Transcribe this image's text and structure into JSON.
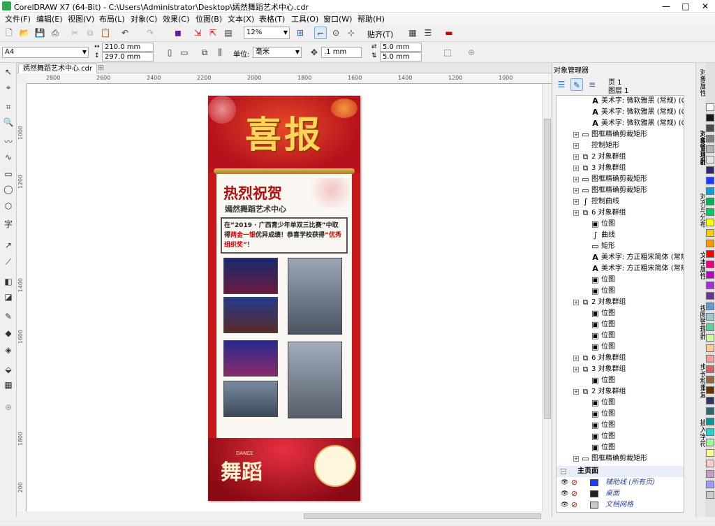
{
  "window": {
    "title": "CorelDRAW X7 (64-Bit) - C:\\Users\\Administrator\\Desktop\\嫣然舞蹈艺术中心.cdr",
    "minimize": "—",
    "maximize": "□",
    "close": "✕"
  },
  "menu": [
    "文件(F)",
    "编辑(E)",
    "视图(V)",
    "布局(L)",
    "对象(C)",
    "效果(C)",
    "位图(B)",
    "文本(X)",
    "表格(T)",
    "工具(O)",
    "窗口(W)",
    "帮助(H)"
  ],
  "toolbar": {
    "zoom": "12%",
    "snap_label": "贴齐(T)"
  },
  "propertybar": {
    "page_size": "A4",
    "width": "210.0 mm",
    "height": "297.0 mm",
    "unit_label": "单位:",
    "unit": "毫米",
    "nudge": ".1 mm",
    "dup_x": "5.0 mm",
    "dup_y": "5.0 mm"
  },
  "document": {
    "tab": "嫣然舞蹈艺术中心.cdr",
    "ruler_h": [
      "2800",
      "2600",
      "2400",
      "2200",
      "2000",
      "1800",
      "1600",
      "1400",
      "1200",
      "1000"
    ],
    "ruler_v": [
      "1000",
      "1200",
      "1400",
      "1600",
      "1800",
      "200"
    ]
  },
  "poster": {
    "title": "喜报",
    "headline": "热烈祝贺",
    "school": "嫣然舞蹈艺术中心",
    "body_1": "在“2019 · 广西青少年单双三比赛”中取得",
    "body_highlight_1": "两金一银",
    "body_2": "优异成绩！恭喜学校获得",
    "body_highlight_2": "“优秀组织奖”",
    "body_end": "！",
    "dance": "舞蹈",
    "dance_en": "DANCE"
  },
  "object_manager": {
    "title": "对象管理器",
    "page": "页 1",
    "layer": "图层 1",
    "rows": [
      {
        "indent": 1,
        "icon": "text-a-icon",
        "label": "美术字: 微软雅黑 (常规) (CH"
      },
      {
        "indent": 1,
        "icon": "text-a-icon",
        "label": "美术字: 微软雅黑 (常规) (CH"
      },
      {
        "indent": 1,
        "icon": "text-a-icon",
        "label": "美术字: 微软雅黑 (常规) (CH"
      },
      {
        "indent": 0,
        "icon": "rect-icon",
        "label": "图框精确剪裁矩形"
      },
      {
        "indent": 0,
        "icon": "",
        "label": "控制矩形"
      },
      {
        "indent": 0,
        "icon": "group-icon",
        "label": "2 对象群组"
      },
      {
        "indent": 0,
        "icon": "group-icon",
        "label": "3 对象群组"
      },
      {
        "indent": 0,
        "icon": "rect-icon",
        "label": "图框精确剪裁矩形"
      },
      {
        "indent": 0,
        "icon": "rect-icon",
        "label": "图框精确剪裁矩形"
      },
      {
        "indent": 0,
        "icon": "curve-icon",
        "label": "控制曲线"
      },
      {
        "indent": 0,
        "icon": "group-icon",
        "label": "6 对象群组"
      },
      {
        "indent": 1,
        "icon": "bitmap-icon",
        "label": "位图"
      },
      {
        "indent": 1,
        "icon": "curve-icon",
        "label": "曲线"
      },
      {
        "indent": 1,
        "icon": "rect-icon",
        "label": "矩形"
      },
      {
        "indent": 1,
        "icon": "text-a-icon",
        "label": "美术字: 方正粗宋简体 (常规)"
      },
      {
        "indent": 1,
        "icon": "text-a-icon",
        "label": "美术字: 方正粗宋简体 (常规)"
      },
      {
        "indent": 1,
        "icon": "bitmap-icon",
        "label": "位图"
      },
      {
        "indent": 1,
        "icon": "bitmap-icon",
        "label": "位图"
      },
      {
        "indent": 0,
        "icon": "group-icon",
        "label": "2 对象群组"
      },
      {
        "indent": 1,
        "icon": "bitmap-icon",
        "label": "位图"
      },
      {
        "indent": 1,
        "icon": "bitmap-icon",
        "label": "位图"
      },
      {
        "indent": 1,
        "icon": "bitmap-icon",
        "label": "位图"
      },
      {
        "indent": 1,
        "icon": "bitmap-icon",
        "label": "位图"
      },
      {
        "indent": 0,
        "icon": "group-icon",
        "label": "6 对象群组"
      },
      {
        "indent": 0,
        "icon": "group-icon",
        "label": "3 对象群组"
      },
      {
        "indent": 1,
        "icon": "bitmap-icon",
        "label": "位图"
      },
      {
        "indent": 0,
        "icon": "group-icon",
        "label": "2 对象群组"
      },
      {
        "indent": 1,
        "icon": "bitmap-icon",
        "label": "位图"
      },
      {
        "indent": 1,
        "icon": "bitmap-icon",
        "label": "位图"
      },
      {
        "indent": 1,
        "icon": "bitmap-icon",
        "label": "位图"
      },
      {
        "indent": 1,
        "icon": "bitmap-icon",
        "label": "位图"
      },
      {
        "indent": 1,
        "icon": "bitmap-icon",
        "label": "位图"
      },
      {
        "indent": 0,
        "icon": "rect-icon",
        "label": "图框精确剪裁矩形"
      }
    ],
    "master_page": "主页面",
    "master_rows": [
      {
        "label": "辅助线 (所有页)",
        "color": "#1a3cff"
      },
      {
        "label": "桌面",
        "color": "#222222"
      },
      {
        "label": "文档网格",
        "color": "#c8c8c8"
      }
    ]
  },
  "docker_tabs": [
    "对象属性",
    "对象管理器",
    "对齐与分布",
    "文本属性",
    "视图管理器",
    "步长和重复",
    "插入字符"
  ],
  "palette": [
    "#ffffff",
    "#1a1a1a",
    "#4d4d4d",
    "#808080",
    "#b3b3b3",
    "#e6e6e6",
    "#2a2a6e",
    "#1a3cff",
    "#00a0e9",
    "#00b050",
    "#00cc66",
    "#ffff00",
    "#ffcc00",
    "#ff9900",
    "#ff0000",
    "#e6007e",
    "#c000c0",
    "#9933cc",
    "#663399",
    "#6699cc",
    "#99cccc",
    "#66cc99",
    "#ccff99",
    "#ffcc99",
    "#ff9999",
    "#cc6666",
    "#996633",
    "#663300",
    "#333366",
    "#336666",
    "#009999",
    "#33cccc",
    "#99ff99",
    "#ffff99",
    "#ffcccc",
    "#cc99cc",
    "#9999ff",
    "#cccccc"
  ]
}
